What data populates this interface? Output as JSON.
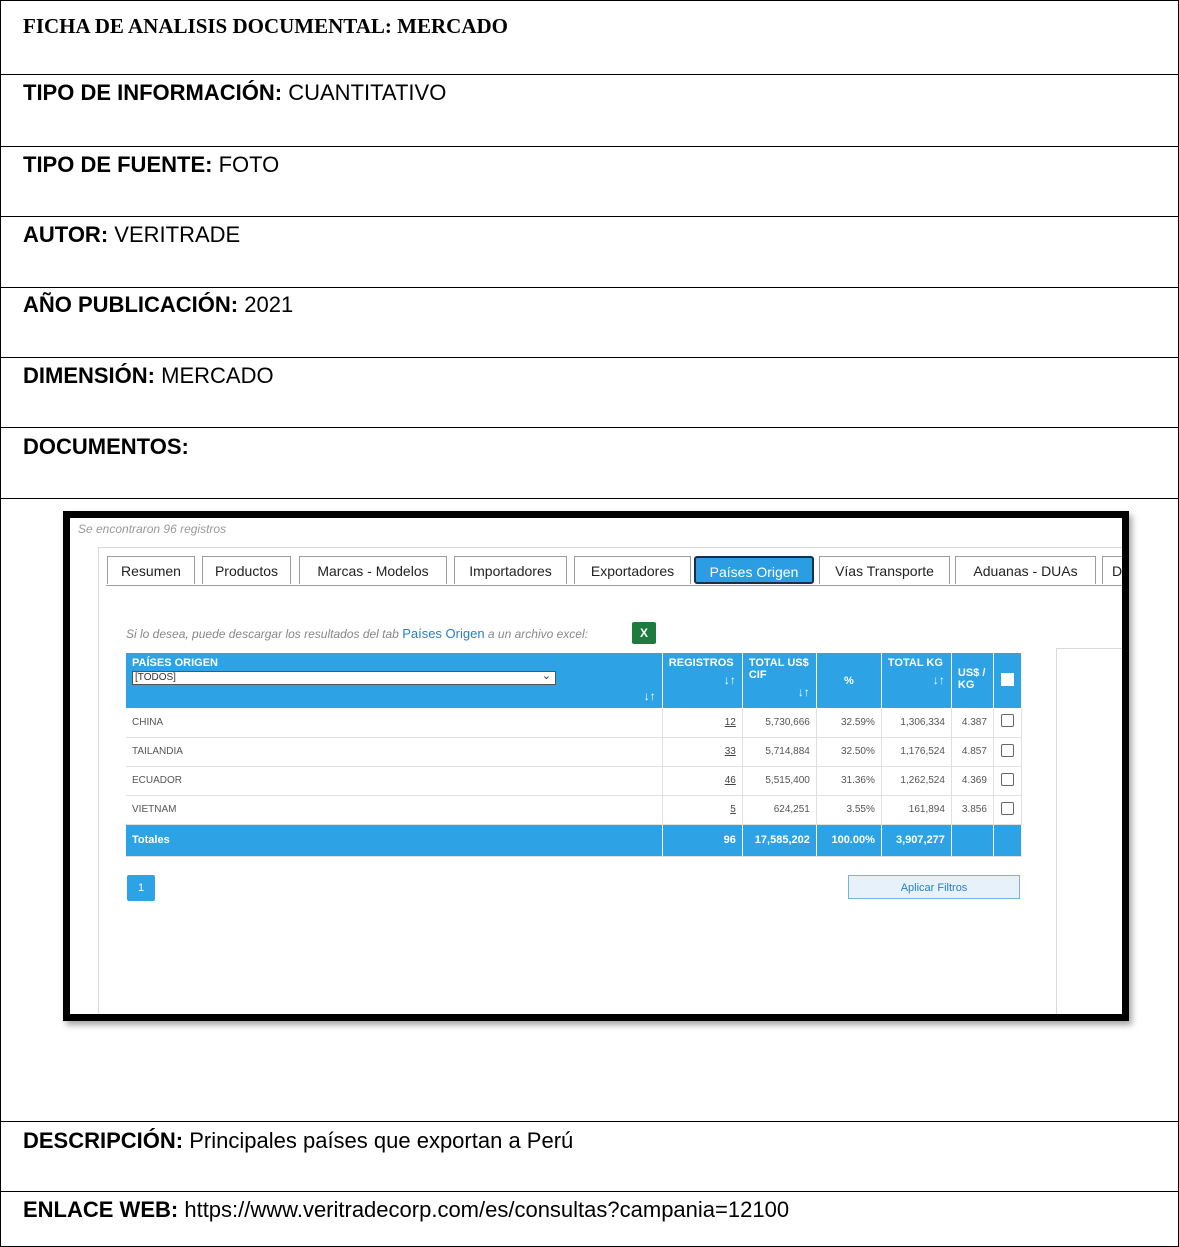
{
  "form": {
    "title": "FICHA DE ANALISIS DOCUMENTAL: MERCADO",
    "tipo_info_label": "TIPO DE INFORMACIÓN:",
    "tipo_info_value": "CUANTITATIVO",
    "tipo_fuente_label": "TIPO DE FUENTE:",
    "tipo_fuente_value": "FOTO",
    "autor_label": "AUTOR:",
    "autor_value": "VERITRADE",
    "anio_label": "AÑO PUBLICACIÓN:",
    "anio_value": "2021",
    "dimension_label": "DIMENSIÓN:",
    "dimension_value": "MERCADO",
    "documentos_label": "DOCUMENTOS:",
    "descripcion_label": "DESCRIPCIÓN:",
    "descripcion_value": "Principales países que exportan a Perú",
    "enlace_label": "ENLACE WEB:",
    "enlace_value": "https://www.veritradecorp.com/es/consultas?campania=12100"
  },
  "shot": {
    "found_text": "Se encontraron 96 registros",
    "tabs": [
      "Resumen",
      "Productos",
      "Marcas - Modelos",
      "Importadores",
      "Exportadores",
      "Países Origen",
      "Vías Transporte",
      "Aduanas - DUAs",
      "D"
    ],
    "active_tab": "Países Origen",
    "hint_pre": "Si lo desea, puede descargar los resultados del tab",
    "hint_link": "Países Origen",
    "hint_post": "a un archivo excel:",
    "excel_icon": "X",
    "headers": {
      "pais": "PAÍSES ORIGEN",
      "select_value": "[TODOS]",
      "registros": "REGISTROS",
      "total_cif": "TOTAL US$ CIF",
      "pct": "%",
      "total_kg": "TOTAL KG",
      "uskg": "US$ / KG",
      "sort": "↓↑"
    },
    "rows": [
      {
        "pais": "CHINA",
        "registros": "12",
        "cif": "5,730,666",
        "pct": "32.59%",
        "kg": "1,306,334",
        "uskg": "4.387"
      },
      {
        "pais": "TAILANDIA",
        "registros": "33",
        "cif": "5,714,884",
        "pct": "32.50%",
        "kg": "1,176,524",
        "uskg": "4.857"
      },
      {
        "pais": "ECUADOR",
        "registros": "46",
        "cif": "5,515,400",
        "pct": "31.36%",
        "kg": "1,262,524",
        "uskg": "4.369"
      },
      {
        "pais": "VIETNAM",
        "registros": "5",
        "cif": "624,251",
        "pct": "3.55%",
        "kg": "161,894",
        "uskg": "3.856"
      }
    ],
    "totals": {
      "label": "Totales",
      "registros": "96",
      "cif": "17,585,202",
      "pct": "100.00%",
      "kg": "3,907,277"
    },
    "page": "1",
    "apply_label": "Aplicar Filtros"
  }
}
